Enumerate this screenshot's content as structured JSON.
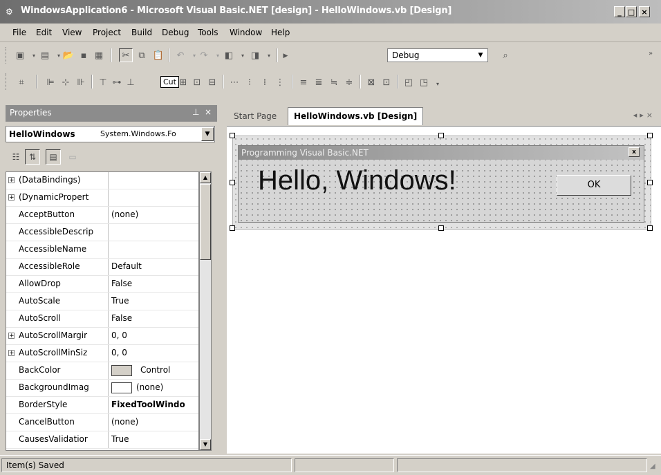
{
  "window": {
    "title": "WindowsApplication6 - Microsoft Visual Basic.NET [design] - HelloWindows.vb [Design]",
    "minimize": "_",
    "maximize": "□",
    "close": "×"
  },
  "menu": [
    "File",
    "Edit",
    "View",
    "Project",
    "Build",
    "Debug",
    "Tools",
    "Window",
    "Help"
  ],
  "toolbar": {
    "config": "Debug",
    "tooltip": "Cut"
  },
  "properties": {
    "title": "Properties",
    "object_name": "HelloWindows",
    "object_type": "System.Windows.Fo",
    "rows": [
      {
        "name": "(DataBindings)",
        "value": "",
        "expand": "+"
      },
      {
        "name": "(DynamicPropert",
        "value": "",
        "expand": "+"
      },
      {
        "name": "AcceptButton",
        "value": "(none)"
      },
      {
        "name": "AccessibleDescrip",
        "value": ""
      },
      {
        "name": "AccessibleName",
        "value": ""
      },
      {
        "name": "AccessibleRole",
        "value": "Default"
      },
      {
        "name": "AllowDrop",
        "value": "False"
      },
      {
        "name": "AutoScale",
        "value": "True"
      },
      {
        "name": "AutoScroll",
        "value": "False"
      },
      {
        "name": "AutoScrollMargir",
        "value": "0, 0",
        "expand": "+"
      },
      {
        "name": "AutoScrollMinSiz",
        "value": "0, 0",
        "expand": "+"
      },
      {
        "name": "BackColor",
        "value": "Control",
        "swatch": "#d4d0c8"
      },
      {
        "name": "BackgroundImag",
        "value": "(none)",
        "swatch": "#ffffff"
      },
      {
        "name": "BorderStyle",
        "value": "FixedToolWindo",
        "bold": true
      },
      {
        "name": "CancelButton",
        "value": "(none)"
      },
      {
        "name": "CausesValidatior",
        "value": "True"
      }
    ]
  },
  "document": {
    "tab_start": "Start Page",
    "tab_active": "HelloWindows.vb [Design]",
    "form_title": "Programming Visual Basic.NET",
    "form_close": "x",
    "label_text": "Hello, Windows!",
    "button_text": "OK"
  },
  "status": {
    "text": "Item(s) Saved"
  }
}
